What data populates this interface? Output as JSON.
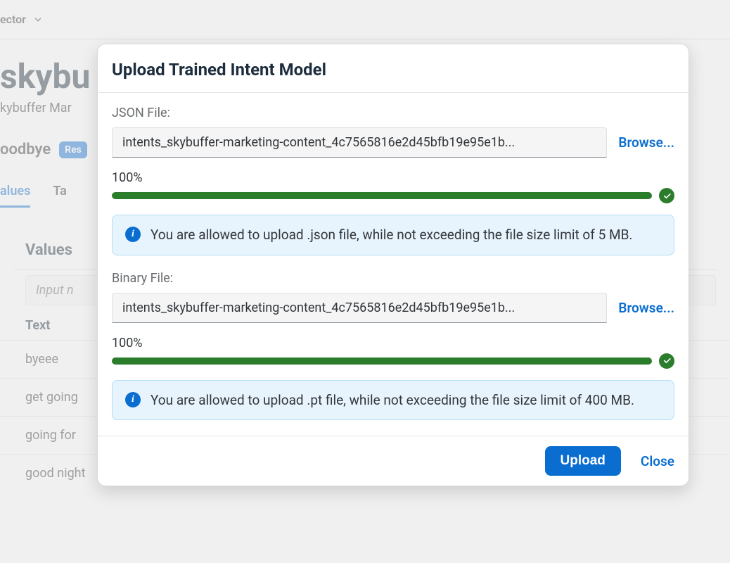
{
  "background": {
    "selector_label": "ector",
    "page_title": "skybu",
    "page_subtitle": "kybuffer Mar",
    "intent_label": "oodbye",
    "badge": "Res",
    "tabs": {
      "values": "alues",
      "ta": "Ta"
    },
    "section_title": "Values",
    "input_placeholder": "Input n",
    "th_text": "Text",
    "rows": [
      "byeee",
      "get going",
      "going for",
      "good night"
    ]
  },
  "modal": {
    "title": "Upload Trained Intent Model",
    "json_file": {
      "label": "JSON File:",
      "filename": "intents_skybuffer-marketing-content_4c7565816e2d45bfb19e95e1b...",
      "browse": "Browse...",
      "progress": "100%",
      "info": "You are allowed to upload .json file, while not exceeding the file size limit of 5 MB."
    },
    "binary_file": {
      "label": "Binary File:",
      "filename": "intents_skybuffer-marketing-content_4c7565816e2d45bfb19e95e1b...",
      "browse": "Browse...",
      "progress": "100%",
      "info": "You are allowed to upload .pt file, while not exceeding the file size limit of 400 MB."
    },
    "footer": {
      "upload": "Upload",
      "close": "Close"
    }
  }
}
